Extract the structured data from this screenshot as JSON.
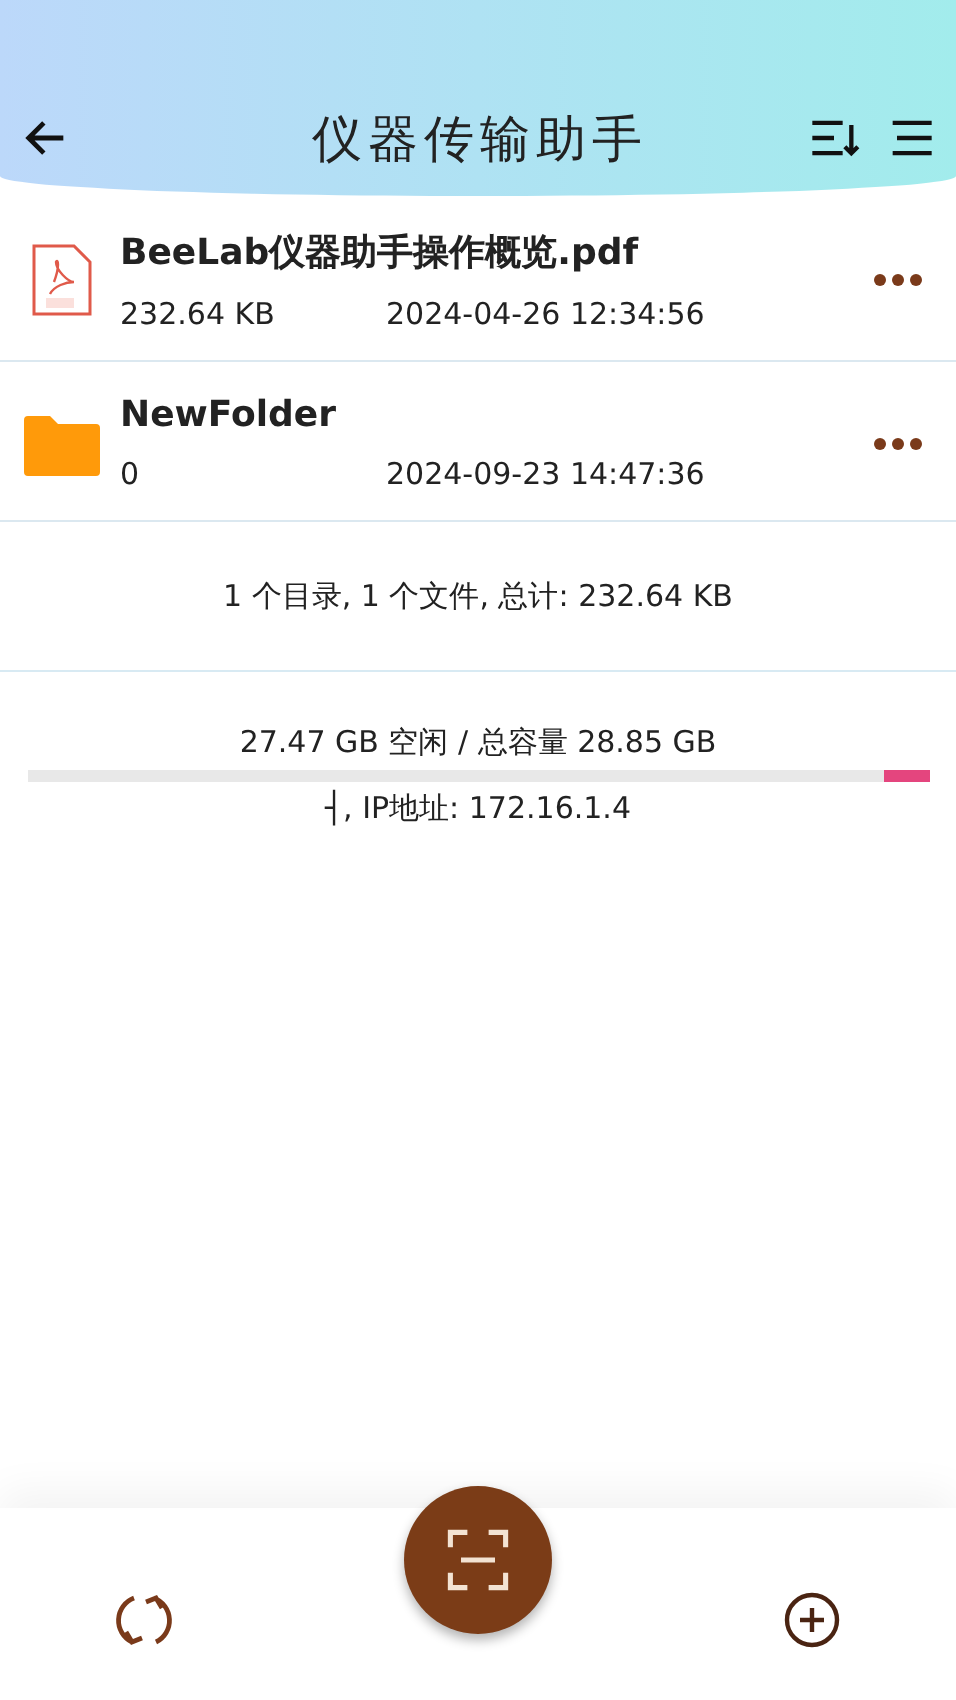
{
  "header": {
    "title": "仪器传输助手"
  },
  "files": [
    {
      "kind": "pdf",
      "name": "BeeLab仪器助手操作概览.pdf",
      "size": "232.64 KB",
      "date": "2024-04-26 12:34:56"
    },
    {
      "kind": "folder",
      "name": "NewFolder",
      "size": "0",
      "date": "2024-09-23 14:47:36"
    }
  ],
  "summary": "1 个目录, 1 个文件, 总计: 232.64 KB",
  "storage": {
    "text": "27.47 GB 空闲 / 总容量 28.85 GB",
    "level": 0.05,
    "ip": "┤, IP地址: 172.16.1.4"
  }
}
